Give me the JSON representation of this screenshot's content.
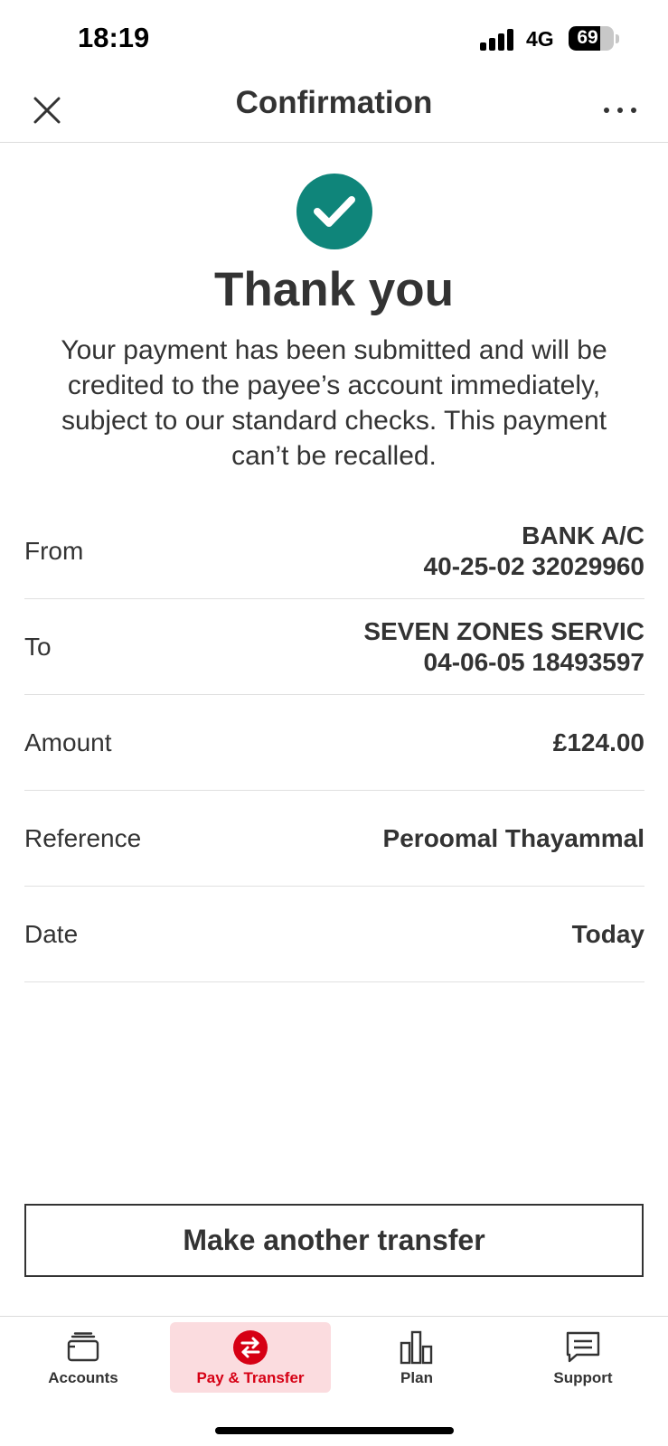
{
  "status_bar": {
    "time": "18:19",
    "network": "4G",
    "battery_percent": 69,
    "battery_text": "69"
  },
  "header": {
    "title": "Confirmation",
    "close_icon": "close-icon",
    "more_icon": "more-options-icon"
  },
  "confirmation": {
    "icon": "checkmark-icon",
    "icon_color": "#0f857a",
    "title": "Thank you",
    "message": "Your payment has been submitted and will be credited to the payee’s account immediately, subject to our standard checks. This payment can’t be recalled."
  },
  "details": {
    "from": {
      "label": "From",
      "line1": "BANK A/C",
      "line2": "40-25-02 32029960"
    },
    "to": {
      "label": "To",
      "line1": "SEVEN ZONES SERVIC",
      "line2": "04-06-05 18493597"
    },
    "amount": {
      "label": "Amount",
      "value": "£124.00"
    },
    "reference": {
      "label": "Reference",
      "value": "Peroomal Thayammal"
    },
    "date": {
      "label": "Date",
      "value": "Today"
    }
  },
  "actions": {
    "make_another_transfer": "Make another transfer"
  },
  "tabbar": {
    "accent_color": "#d60014",
    "tabs": [
      {
        "label": "Accounts",
        "icon": "wallet-icon",
        "active": false
      },
      {
        "label": "Pay & Transfer",
        "icon": "transfer-arrows-icon",
        "active": true
      },
      {
        "label": "Plan",
        "icon": "bar-chart-icon",
        "active": false
      },
      {
        "label": "Support",
        "icon": "chat-bubble-icon",
        "active": false
      }
    ]
  }
}
